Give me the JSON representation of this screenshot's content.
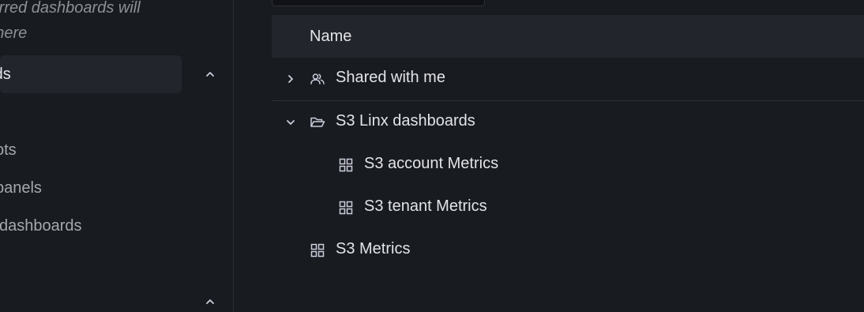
{
  "sidebar": {
    "starred_hint": "Your starred dashboards will appear here",
    "starred_hint_visible": "tarred dashboards will\nr here",
    "section_label": "rds",
    "items": [
      {
        "label": "ots"
      },
      {
        "label": "panels"
      },
      {
        "label": "dashboards"
      }
    ]
  },
  "table": {
    "header_name": "Name",
    "rows": [
      {
        "label": "Shared with me",
        "icon": "users-icon",
        "expander": "chevron-right-icon"
      },
      {
        "label": "S3 Linx dashboards",
        "icon": "folder-open-icon",
        "expander": "chevron-down-icon"
      },
      {
        "label": "S3 account Metrics",
        "icon": "apps-icon"
      },
      {
        "label": "S3 tenant Metrics",
        "icon": "apps-icon"
      },
      {
        "label": "S3 Metrics",
        "icon": "apps-icon"
      }
    ]
  },
  "colors": {
    "background": "#181b1f",
    "header_bg": "#22252b",
    "text": "#e3e4e8",
    "muted": "#8e9097"
  }
}
